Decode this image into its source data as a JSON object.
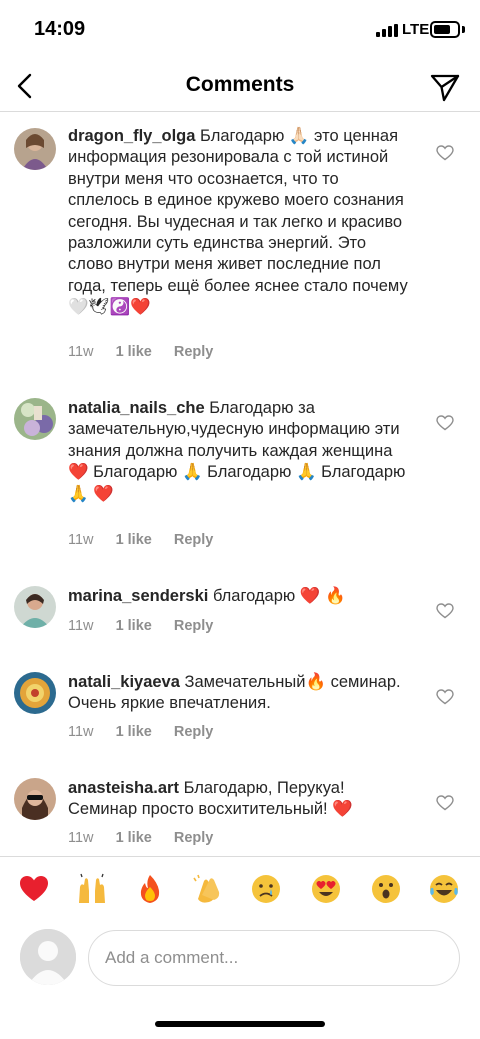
{
  "status_bar": {
    "time": "14:09",
    "network": "LTE"
  },
  "header": {
    "title": "Comments"
  },
  "comments": [
    {
      "username": "dragon_fly_olga",
      "text": "Благодарю 🙏🏻 это ценная информация резонировала с той истиной внутри меня что осознается, что то сплелось в единое кружево моего сознания сегодня. Вы чудесная и так легко и красиво разложили суть единства энергий. Это слово внутри меня живет последние пол года, теперь ещё более яснее стало почему 🤍🕊☯️❤️",
      "time": "11w",
      "likes": "1 like",
      "reply": "Reply"
    },
    {
      "username": "natalia_nails_che",
      "text": "Благодарю за замечательную,чудесную информацию эти знания должна получить каждая женщина ❤️ Благодарю 🙏 Благодарю 🙏 Благодарю 🙏 ❤️",
      "time": "11w",
      "likes": "1 like",
      "reply": "Reply"
    },
    {
      "username": "marina_senderski",
      "text": "благодарю ❤️ 🔥",
      "time": "11w",
      "likes": "1 like",
      "reply": "Reply"
    },
    {
      "username": "natali_kiyaeva",
      "text": "Замечательный🔥 семинар. Очень яркие впечатления.",
      "time": "11w",
      "likes": "1 like",
      "reply": "Reply"
    },
    {
      "username": "anasteisha.art",
      "text": "Благодарю, Перукуа! Семинар просто восхитительный! ❤️",
      "time": "11w",
      "likes": "1 like",
      "reply": "Reply"
    }
  ],
  "reactions": [
    {
      "name": "heart",
      "glyph": "❤️"
    },
    {
      "name": "raising-hands",
      "glyph": "🙌"
    },
    {
      "name": "fire",
      "glyph": "🔥"
    },
    {
      "name": "clapping-hands",
      "glyph": "👏"
    },
    {
      "name": "crying-face",
      "glyph": "😢"
    },
    {
      "name": "heart-eyes",
      "glyph": "😍"
    },
    {
      "name": "astonished-face",
      "glyph": "😮"
    },
    {
      "name": "tears-of-joy",
      "glyph": "😂"
    }
  ],
  "composer": {
    "placeholder": "Add a comment..."
  },
  "colors": {
    "text": "#262626",
    "meta": "#8e8e8e",
    "heart": "#ed4956",
    "border": "#dbdbdb"
  },
  "icons": [
    "back-arrow-icon",
    "send-direct-icon",
    "heart-outline-icon",
    "user-placeholder-icon"
  ]
}
